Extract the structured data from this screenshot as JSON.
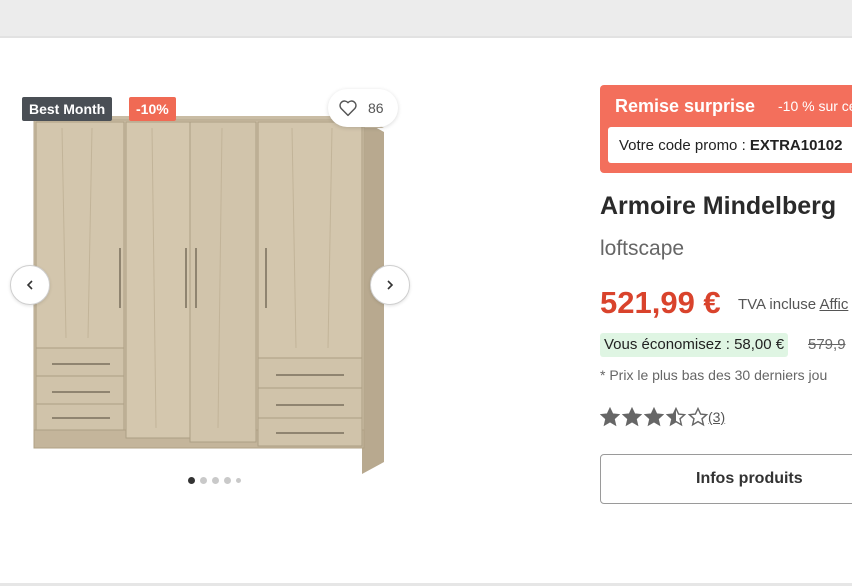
{
  "badges": {
    "best": "Best Month",
    "discount": "-10%"
  },
  "favorites": {
    "count": "86",
    "icon": "heart-icon"
  },
  "gallery": {
    "dots_total": 5,
    "active_dot": 1,
    "prev_icon": "chevron-left-icon",
    "next_icon": "chevron-right-icon"
  },
  "promo": {
    "title": "Remise surprise",
    "subtitle": "-10 % sur ce",
    "code_label": "Votre code promo : ",
    "code": "EXTRA10102"
  },
  "product": {
    "title": "Armoire Mindelberg",
    "brand": "loftscape",
    "price": "521,99 €",
    "vat_text": "TVA incluse",
    "vat_link": "Affic",
    "savings": "Vous économisez : 58,00 €",
    "old_price": "579,9",
    "lowest_note": "* Prix le plus bas des 30 derniers jou",
    "rating": {
      "value": 3.5,
      "max": 5,
      "count": "(3)"
    },
    "info_button": "Infos produits"
  },
  "colors": {
    "accent": "#d9432c",
    "promo_bg": "#f36f5c",
    "savings_bg": "#dff5e3",
    "badge_dark": "#4a4f55",
    "badge_red": "#f06a54"
  }
}
